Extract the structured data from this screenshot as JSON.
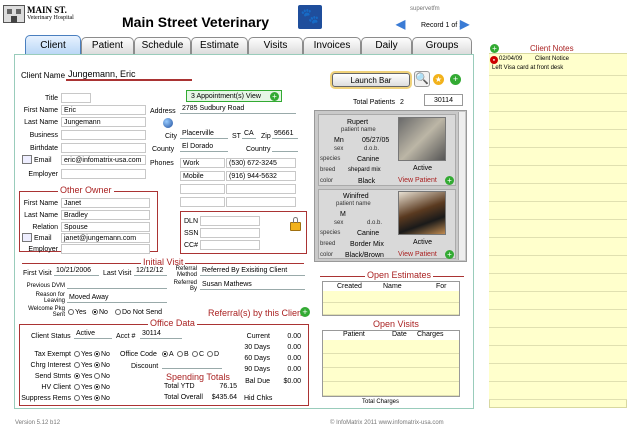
{
  "header": {
    "logo_line1": "MAIN ST.",
    "logo_line2": "Veterinary Hospital",
    "title": "Main Street Veterinary",
    "user": "supervetfm",
    "record": "Record 1 of 1"
  },
  "tabs": [
    "Client",
    "Patient",
    "Schedule",
    "Estimate",
    "Visits",
    "Invoices",
    "Daily",
    "Groups"
  ],
  "client": {
    "name_label": "Client Name",
    "name": "Jungemann, Eric",
    "appointments_button": "3  Appointment(s) View",
    "title_label": "Title",
    "title": "",
    "first_label": "First Name",
    "first": "Eric",
    "last_label": "Last Name",
    "last": "Jungemann",
    "business_label": "Business",
    "business": "",
    "birthdate_label": "Birthdate",
    "birthdate": "",
    "email_label": "Email",
    "email": "eric@infomatrix-usa.com",
    "employer_label": "Employer",
    "employer": "",
    "address_label": "Address",
    "address": "2785 Sudbury Road",
    "city_label": "City",
    "city": "Placerville",
    "st_label": "ST",
    "st": "CA",
    "zip_label": "Zip",
    "zip": "95661",
    "county_label": "County",
    "county": "El Dorado",
    "country_label": "Country",
    "country": "",
    "phones_label": "Phones",
    "phones": [
      {
        "type": "Work",
        "number": "(530) 672-3245"
      },
      {
        "type": "Mobile",
        "number": "(916) 944-5632"
      }
    ]
  },
  "other_owner": {
    "heading": "Other Owner",
    "first_label": "First Name",
    "first": "Janet",
    "last_label": "Last Name",
    "last": "Bradley",
    "relation_label": "Relation",
    "relation": "Spouse",
    "email_label": "Email",
    "email": "janet@jungemann.com",
    "employer_label": "Employer",
    "employer": ""
  },
  "secure": {
    "dln_label": "DLN",
    "ssn_label": "SSN",
    "cc_label": "CC#"
  },
  "launch_bar": "Launch Bar",
  "total_patients_label": "Total Patients",
  "total_patients": "2",
  "account_no": "30114",
  "patients": [
    {
      "name": "Rupert",
      "name_label": "patient name",
      "sex_label": "sex",
      "sex": "Mn",
      "dob_label": "d.o.b.",
      "dob": "05/27/05",
      "species_label": "species",
      "species": "Canine",
      "breed_label": "breed",
      "breed": "shepard mix",
      "color_label": "color",
      "color": "Black",
      "status": "Active",
      "view": "View Patient"
    },
    {
      "name": "Winifred",
      "name_label": "patient name",
      "sex_label": "sex",
      "sex": "M",
      "dob_label": "d.o.b.",
      "dob": "",
      "species_label": "species",
      "species": "Canine",
      "breed_label": "breed",
      "breed": "Border Mix",
      "color_label": "color",
      "color": "Black/Brown",
      "status": "Active",
      "view": "View Patient"
    }
  ],
  "initial_visit": {
    "heading": "Initial Visit",
    "first_label": "First Visit",
    "first": "10/21/2006",
    "last_label": "Last Visit",
    "last": "12/12/12",
    "method_label": "Referral Method",
    "method": "Referred By Exisiting Client",
    "by_label": "Referred By",
    "by": "Susan Mathews",
    "prev_dvm_label": "Previous DVM",
    "prev_dvm": "",
    "reason_label": "Reason for Leaving",
    "reason": "Moved Away",
    "welcome_label": "Welcome Pkg Sent",
    "welcome_opts": [
      "Yes",
      "No",
      "Do Not Send"
    ],
    "referrals_label": "Referral(s) by this Client"
  },
  "office": {
    "heading": "Office Data",
    "status_label": "Client Status",
    "status": "Active",
    "acct_label": "Acct #",
    "acct": "30114",
    "tax_label": "Tax Exempt",
    "chrg_label": "Chrg Interest",
    "stmts_label": "Send Stmts",
    "hv_label": "HV Client",
    "supp_label": "Suppress Rems",
    "yes": "Yes",
    "no": "No",
    "code_label": "Office Code",
    "codes": [
      "A",
      "B",
      "C",
      "D"
    ],
    "discount_label": "Discount",
    "spending_heading": "Spending Totals",
    "ytd_label": "Total YTD",
    "ytd": "76.15",
    "overall_label": "Total Overall",
    "overall": "$435.64",
    "current_label": "Current",
    "current": "0.00",
    "d30_label": "30 Days",
    "d30": "0.00",
    "d60_label": "60 Days",
    "d60": "0.00",
    "d90_label": "90 Days",
    "d90": "0.00",
    "bal_label": "Bal Due",
    "bal": "$0.00",
    "hid_label": "Hid Chks"
  },
  "open_estimates": {
    "heading": "Open Estimates",
    "cols": [
      "Created",
      "Name",
      "For"
    ]
  },
  "open_visits": {
    "heading": "Open Visits",
    "cols": [
      "Patient",
      "Date",
      "Charges"
    ],
    "total_label": "Total Charges"
  },
  "notes": {
    "heading": "Client Notes",
    "entries": [
      {
        "date": "02/04/09",
        "text": "Client Notice",
        "detail": "Left Visa card at front desk"
      }
    ]
  },
  "footer": {
    "version": "Version 5.12 b12",
    "copyright": "© InfoMatrix 2011 www.infomatrix-usa.com"
  },
  "colors": {
    "accent": "#3a7bd5",
    "section": "#aa2222",
    "note_bg": "#ffffcc"
  }
}
